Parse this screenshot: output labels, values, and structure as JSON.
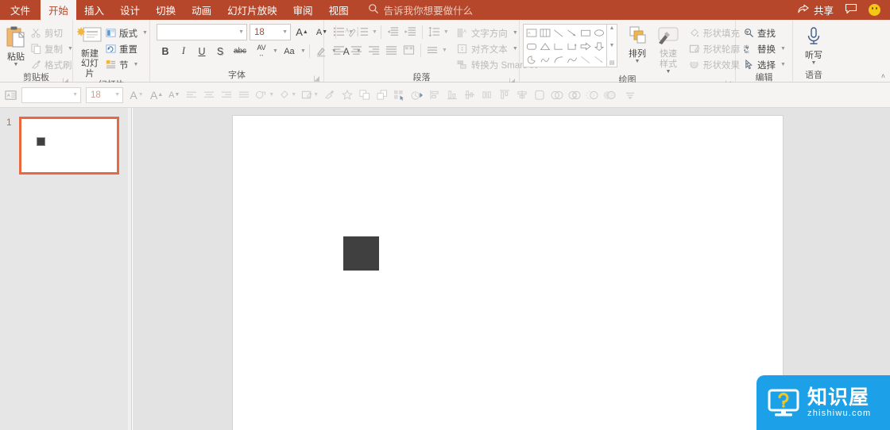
{
  "app": {
    "accent_color": "#b7472a",
    "ribbon_bg": "#f5f4f2",
    "selection_color": "#e8683f",
    "shape_color": "#404040"
  },
  "titlebar": {
    "tabs": [
      {
        "label": "文件",
        "name": "tab-file",
        "active": false
      },
      {
        "label": "开始",
        "name": "tab-home",
        "active": true
      },
      {
        "label": "插入",
        "name": "tab-insert",
        "active": false
      },
      {
        "label": "设计",
        "name": "tab-design",
        "active": false
      },
      {
        "label": "切换",
        "name": "tab-transitions",
        "active": false
      },
      {
        "label": "动画",
        "name": "tab-animations",
        "active": false
      },
      {
        "label": "幻灯片放映",
        "name": "tab-slideshow",
        "active": false
      },
      {
        "label": "审阅",
        "name": "tab-review",
        "active": false
      },
      {
        "label": "视图",
        "name": "tab-view",
        "active": false
      }
    ],
    "tellme_placeholder": "告诉我你想要做什么",
    "share_label": "共享",
    "comments_icon": "comment-icon",
    "account_icon": "smiley-face-icon"
  },
  "ribbon": {
    "groups": {
      "clipboard": {
        "label": "剪贴板",
        "paste": "粘贴",
        "cut": "剪切",
        "copy": "复制",
        "format_painter": "格式刷"
      },
      "slides": {
        "label": "幻灯片",
        "new_slide_line1": "新建",
        "new_slide_line2": "幻灯片",
        "layout": "版式",
        "reset": "重置",
        "section": "节"
      },
      "font": {
        "label": "字体",
        "font_name": "",
        "font_name_placeholder": "",
        "font_size": "18",
        "grow_font": "A",
        "shrink_font": "A",
        "clear_formatting": "清除所有格式",
        "bold": "B",
        "italic": "I",
        "underline": "U",
        "shadow": "S",
        "strikethrough": "abc",
        "char_spacing": "AV",
        "change_case": "Aa",
        "highlight": "A",
        "font_color": "A"
      },
      "paragraph": {
        "label": "段落",
        "text_direction": "文字方向",
        "align_text": "对齐文本",
        "convert_smartart": "转换为 SmartArt"
      },
      "drawing": {
        "label": "绘图",
        "arrange": "排列",
        "quick_styles_line1": "快速样式",
        "shape_fill": "形状填充",
        "shape_outline": "形状轮廓",
        "shape_effects": "形状效果"
      },
      "editing": {
        "label": "编辑",
        "find": "查找",
        "replace": "替换",
        "select": "选择"
      },
      "voice": {
        "label": "语音",
        "dictate": "听写"
      }
    },
    "collapse_icon": "chevron-up-icon"
  },
  "toolbar2": {
    "font_name": "",
    "font_size": "18",
    "items": [
      "text-box-icon",
      "font-name-combo",
      "font-size-combo",
      "font-color-a-icon",
      "grow-font-icon",
      "shrink-font-icon",
      "align-left-icon",
      "align-center-icon",
      "align-right-icon",
      "align-justify-icon",
      "shape-fill-icon",
      "fill-color-icon",
      "shape-outline-icon",
      "format-painter-icon",
      "star-icon",
      "bring-forward-icon",
      "send-backward-icon",
      "selection-pane-icon",
      "animation-icon",
      "align-objects-icon",
      "align-top-icon",
      "align-middle-icon",
      "distribute-h-icon",
      "align-left-obj-icon",
      "align-center-obj-icon",
      "align-bottom-icon",
      "distribute-v-icon",
      "union-icon",
      "combine-icon",
      "fragment-icon",
      "intersect-icon",
      "subtract-icon",
      "more-icon"
    ]
  },
  "slide_panel": {
    "slide_number": "1",
    "thumbnail_name": "slide-thumbnail-1"
  },
  "canvas": {
    "shape_name": "rectangle-shape",
    "shape_fill": "#404040"
  },
  "watermark": {
    "title": "知识屋",
    "subtitle": "zhishiwu.com",
    "bg_color": "#1ca0e8",
    "icon": "monitor-question-icon"
  }
}
